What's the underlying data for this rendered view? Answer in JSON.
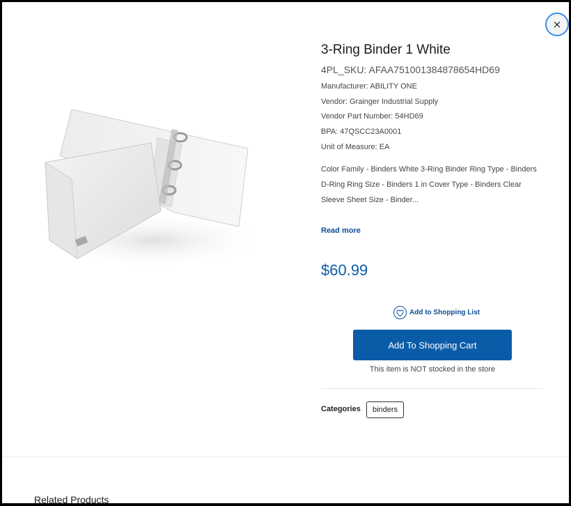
{
  "modal": {
    "close_label": "×"
  },
  "product": {
    "title": "3-Ring Binder 1 White",
    "sku": "4PL_SKU: AFAA751001384878654HD69",
    "manufacturer": "Manufacturer: ABILITY ONE",
    "vendor": "Vendor: Grainger Industrial Supply",
    "vendor_part": "Vendor Part Number: 54HD69",
    "bpa": "BPA: 47QSCC23A0001",
    "unit": "Unit of Measure: EA",
    "description": "Color Family - Binders White 3-Ring Binder Ring Type - Binders D-Ring Ring Size - Binders 1 in Cover Type - Binders Clear Sleeve Sheet Size - Binder...",
    "read_more": "Read more",
    "price": "$60.99",
    "image_icon": "binder-image"
  },
  "actions": {
    "shopping_list": "Add to Shopping List",
    "add_to_cart": "Add To Shopping Cart",
    "stock_note": "This item is NOT stocked in the store"
  },
  "categories": {
    "label": "Categories",
    "items": [
      "binders"
    ]
  },
  "related": {
    "heading": "Related Products"
  },
  "colors": {
    "accent": "#0b5ca8",
    "close_ring": "#3a8ee6"
  }
}
